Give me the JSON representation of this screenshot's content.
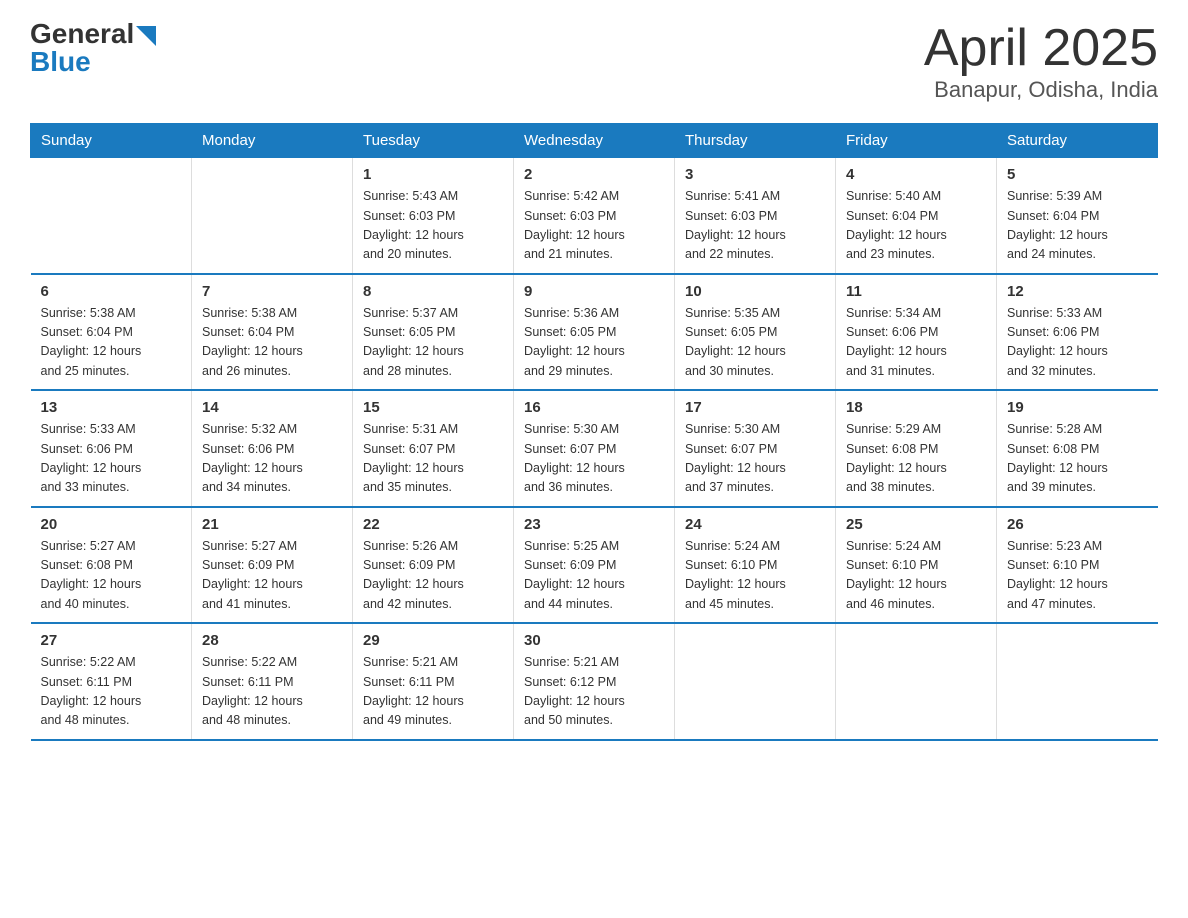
{
  "header": {
    "logo": {
      "general": "General",
      "blue": "Blue"
    },
    "title": "April 2025",
    "subtitle": "Banapur, Odisha, India"
  },
  "weekdays": [
    "Sunday",
    "Monday",
    "Tuesday",
    "Wednesday",
    "Thursday",
    "Friday",
    "Saturday"
  ],
  "weeks": [
    [
      {
        "day": "",
        "info": ""
      },
      {
        "day": "",
        "info": ""
      },
      {
        "day": "1",
        "info": "Sunrise: 5:43 AM\nSunset: 6:03 PM\nDaylight: 12 hours\nand 20 minutes."
      },
      {
        "day": "2",
        "info": "Sunrise: 5:42 AM\nSunset: 6:03 PM\nDaylight: 12 hours\nand 21 minutes."
      },
      {
        "day": "3",
        "info": "Sunrise: 5:41 AM\nSunset: 6:03 PM\nDaylight: 12 hours\nand 22 minutes."
      },
      {
        "day": "4",
        "info": "Sunrise: 5:40 AM\nSunset: 6:04 PM\nDaylight: 12 hours\nand 23 minutes."
      },
      {
        "day": "5",
        "info": "Sunrise: 5:39 AM\nSunset: 6:04 PM\nDaylight: 12 hours\nand 24 minutes."
      }
    ],
    [
      {
        "day": "6",
        "info": "Sunrise: 5:38 AM\nSunset: 6:04 PM\nDaylight: 12 hours\nand 25 minutes."
      },
      {
        "day": "7",
        "info": "Sunrise: 5:38 AM\nSunset: 6:04 PM\nDaylight: 12 hours\nand 26 minutes."
      },
      {
        "day": "8",
        "info": "Sunrise: 5:37 AM\nSunset: 6:05 PM\nDaylight: 12 hours\nand 28 minutes."
      },
      {
        "day": "9",
        "info": "Sunrise: 5:36 AM\nSunset: 6:05 PM\nDaylight: 12 hours\nand 29 minutes."
      },
      {
        "day": "10",
        "info": "Sunrise: 5:35 AM\nSunset: 6:05 PM\nDaylight: 12 hours\nand 30 minutes."
      },
      {
        "day": "11",
        "info": "Sunrise: 5:34 AM\nSunset: 6:06 PM\nDaylight: 12 hours\nand 31 minutes."
      },
      {
        "day": "12",
        "info": "Sunrise: 5:33 AM\nSunset: 6:06 PM\nDaylight: 12 hours\nand 32 minutes."
      }
    ],
    [
      {
        "day": "13",
        "info": "Sunrise: 5:33 AM\nSunset: 6:06 PM\nDaylight: 12 hours\nand 33 minutes."
      },
      {
        "day": "14",
        "info": "Sunrise: 5:32 AM\nSunset: 6:06 PM\nDaylight: 12 hours\nand 34 minutes."
      },
      {
        "day": "15",
        "info": "Sunrise: 5:31 AM\nSunset: 6:07 PM\nDaylight: 12 hours\nand 35 minutes."
      },
      {
        "day": "16",
        "info": "Sunrise: 5:30 AM\nSunset: 6:07 PM\nDaylight: 12 hours\nand 36 minutes."
      },
      {
        "day": "17",
        "info": "Sunrise: 5:30 AM\nSunset: 6:07 PM\nDaylight: 12 hours\nand 37 minutes."
      },
      {
        "day": "18",
        "info": "Sunrise: 5:29 AM\nSunset: 6:08 PM\nDaylight: 12 hours\nand 38 minutes."
      },
      {
        "day": "19",
        "info": "Sunrise: 5:28 AM\nSunset: 6:08 PM\nDaylight: 12 hours\nand 39 minutes."
      }
    ],
    [
      {
        "day": "20",
        "info": "Sunrise: 5:27 AM\nSunset: 6:08 PM\nDaylight: 12 hours\nand 40 minutes."
      },
      {
        "day": "21",
        "info": "Sunrise: 5:27 AM\nSunset: 6:09 PM\nDaylight: 12 hours\nand 41 minutes."
      },
      {
        "day": "22",
        "info": "Sunrise: 5:26 AM\nSunset: 6:09 PM\nDaylight: 12 hours\nand 42 minutes."
      },
      {
        "day": "23",
        "info": "Sunrise: 5:25 AM\nSunset: 6:09 PM\nDaylight: 12 hours\nand 44 minutes."
      },
      {
        "day": "24",
        "info": "Sunrise: 5:24 AM\nSunset: 6:10 PM\nDaylight: 12 hours\nand 45 minutes."
      },
      {
        "day": "25",
        "info": "Sunrise: 5:24 AM\nSunset: 6:10 PM\nDaylight: 12 hours\nand 46 minutes."
      },
      {
        "day": "26",
        "info": "Sunrise: 5:23 AM\nSunset: 6:10 PM\nDaylight: 12 hours\nand 47 minutes."
      }
    ],
    [
      {
        "day": "27",
        "info": "Sunrise: 5:22 AM\nSunset: 6:11 PM\nDaylight: 12 hours\nand 48 minutes."
      },
      {
        "day": "28",
        "info": "Sunrise: 5:22 AM\nSunset: 6:11 PM\nDaylight: 12 hours\nand 48 minutes."
      },
      {
        "day": "29",
        "info": "Sunrise: 5:21 AM\nSunset: 6:11 PM\nDaylight: 12 hours\nand 49 minutes."
      },
      {
        "day": "30",
        "info": "Sunrise: 5:21 AM\nSunset: 6:12 PM\nDaylight: 12 hours\nand 50 minutes."
      },
      {
        "day": "",
        "info": ""
      },
      {
        "day": "",
        "info": ""
      },
      {
        "day": "",
        "info": ""
      }
    ]
  ]
}
